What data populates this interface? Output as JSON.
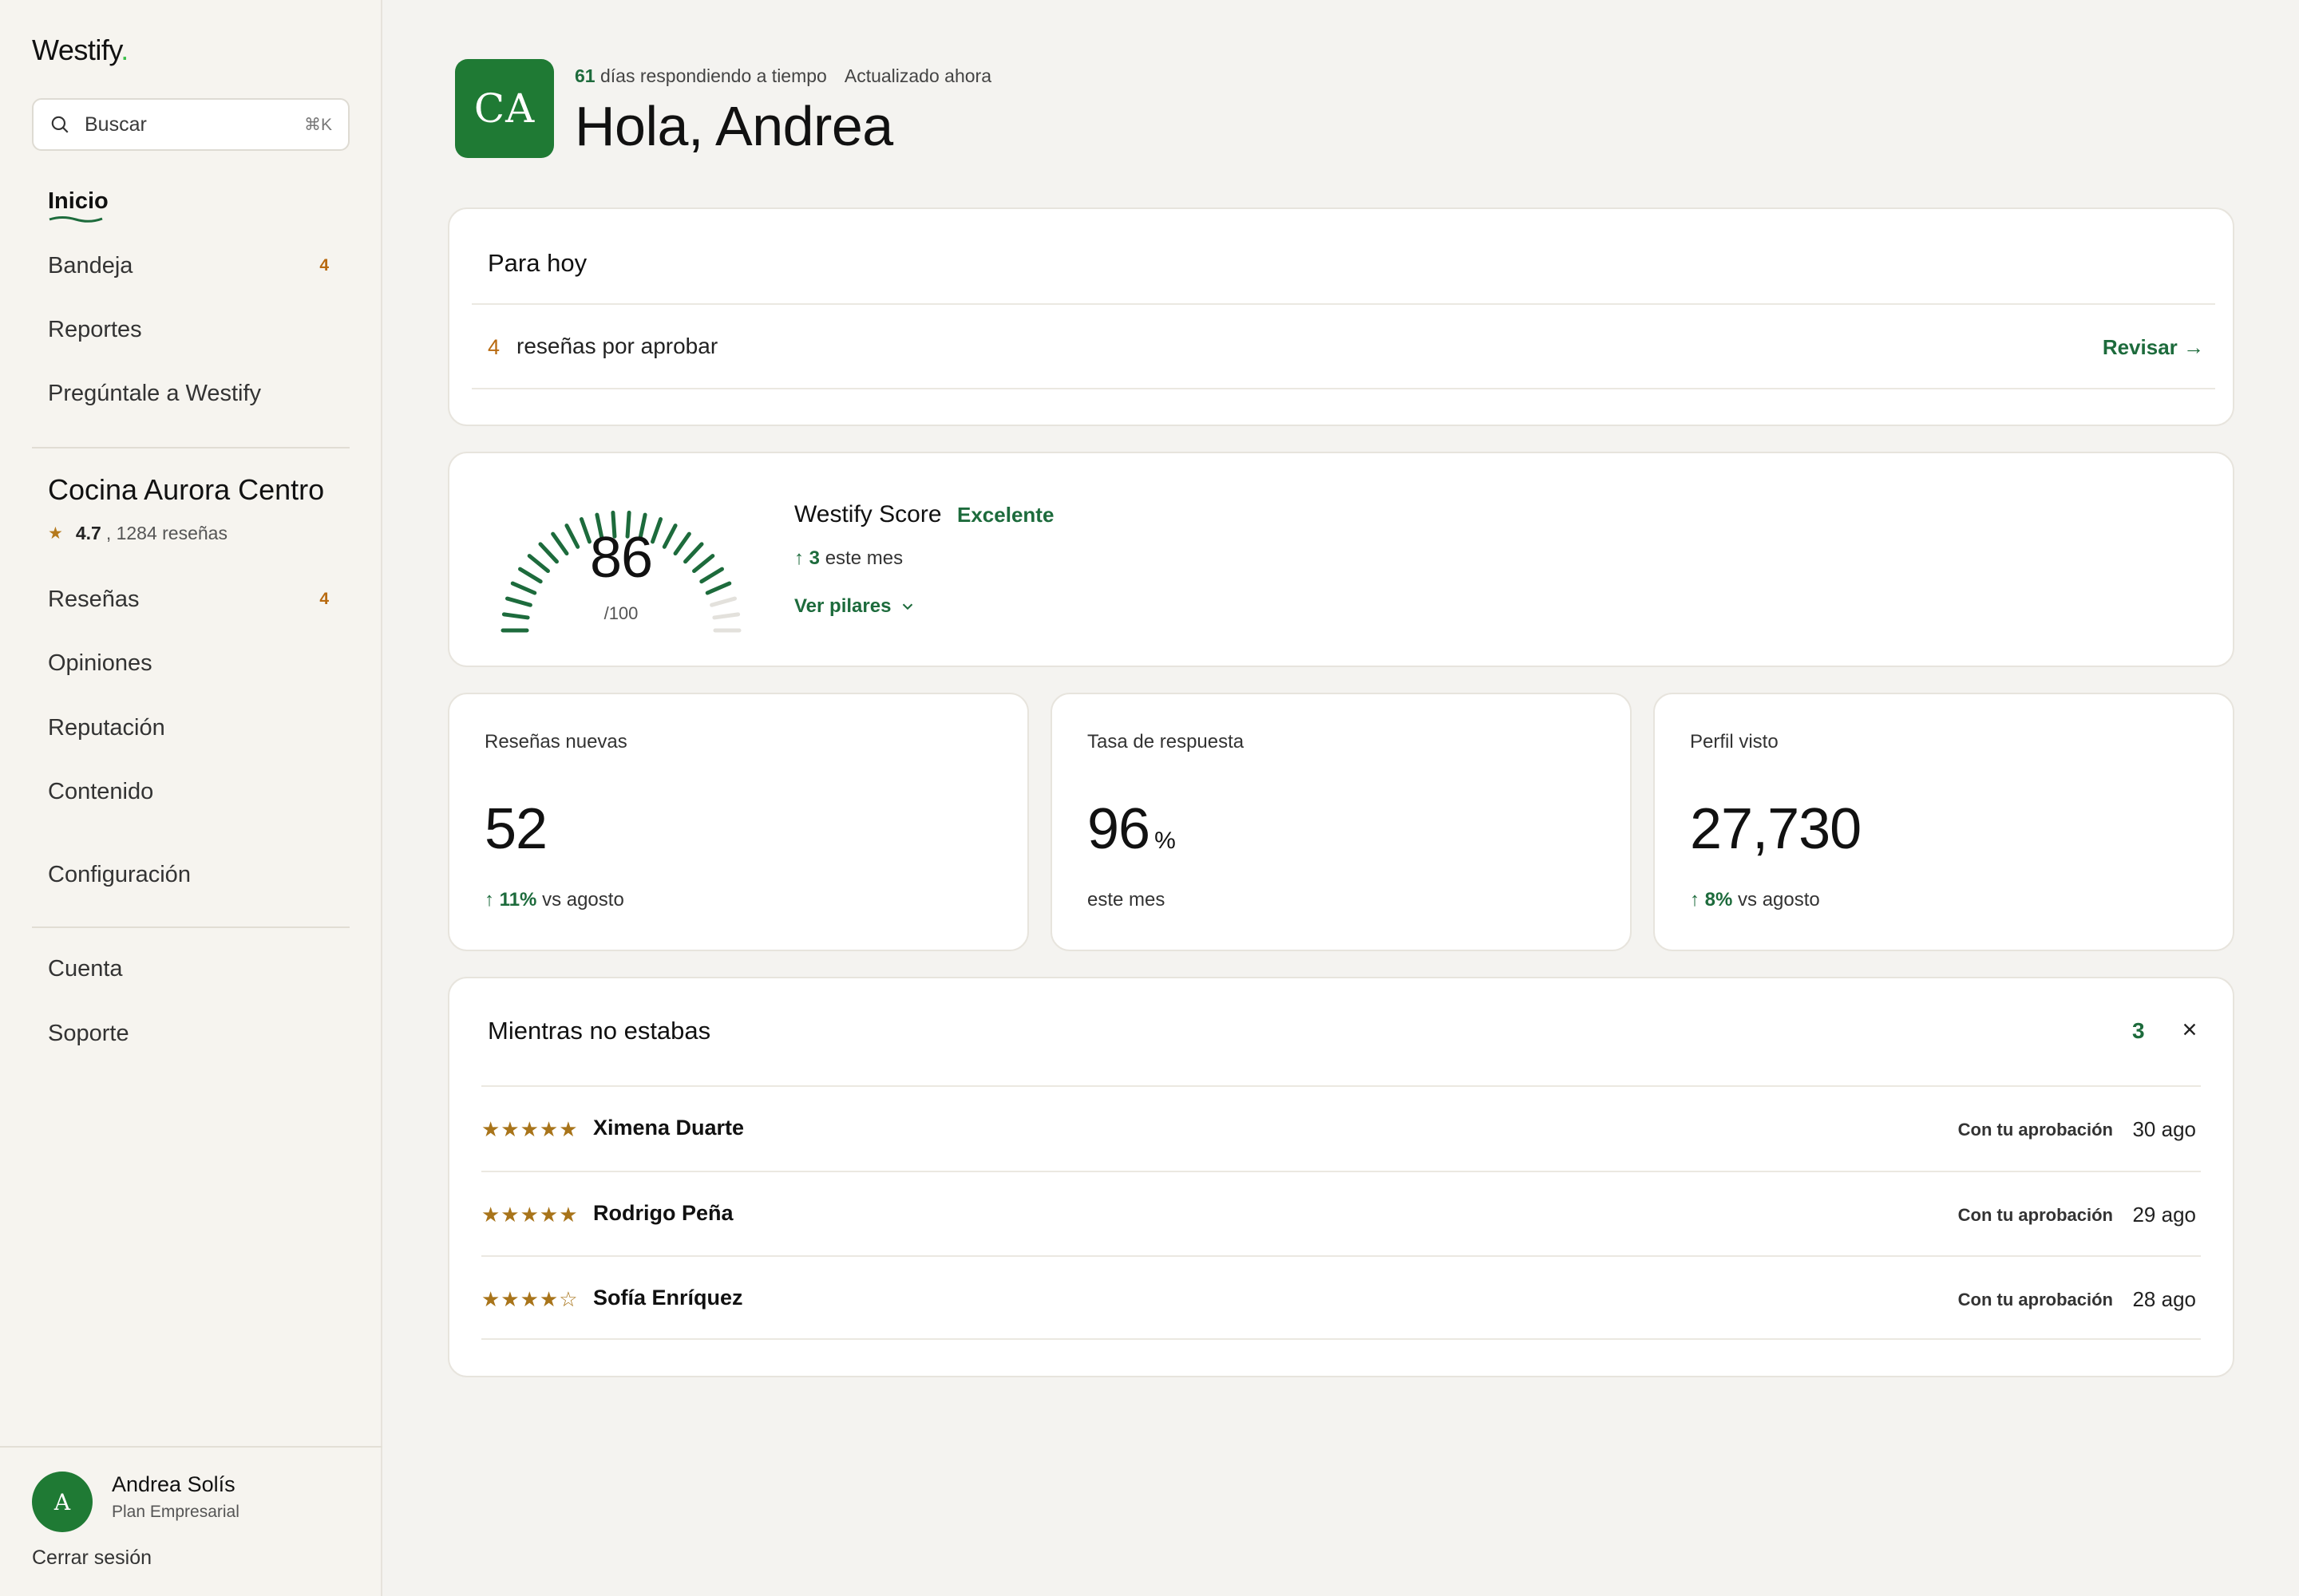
{
  "brand": {
    "name": "Westify",
    "dot": "."
  },
  "search": {
    "placeholder": "Buscar",
    "shortcut": "⌘K"
  },
  "nav_main": [
    {
      "label": "Inicio",
      "active": true
    },
    {
      "label": "Bandeja",
      "badge": "4"
    },
    {
      "label": "Reportes"
    },
    {
      "label": "Pregúntale a Westify"
    }
  ],
  "business": {
    "name": "Cocina Aurora Centro",
    "rating": "4.7",
    "reviews": ", 1284 reseñas"
  },
  "nav_business": [
    {
      "label": "Reseñas",
      "badge": "4"
    },
    {
      "label": "Opiniones"
    },
    {
      "label": "Reputación"
    },
    {
      "label": "Contenido"
    },
    {
      "label": "Configuración"
    }
  ],
  "nav_footer": [
    {
      "label": "Cuenta"
    },
    {
      "label": "Soporte"
    }
  ],
  "user": {
    "initial": "A",
    "name": "Andrea Solís",
    "plan": "Plan Empresarial",
    "logout": "Cerrar sesión"
  },
  "hero": {
    "logo_text": "CA",
    "days": "61",
    "days_text": "días respondiendo a tiempo",
    "updated": "Actualizado ahora",
    "greeting": "Hola, Andrea"
  },
  "today": {
    "title": "Para hoy",
    "count": "4",
    "text": "reseñas por aprobar",
    "action": "Revisar →"
  },
  "score": {
    "value": "86",
    "max": "/100",
    "value_fraction": 0.86,
    "title": "Westify Score",
    "grade": "Excelente",
    "delta": "3",
    "delta_text": "este mes",
    "link": "Ver pilares"
  },
  "metrics": [
    {
      "label": "Reseñas nuevas",
      "value": "52",
      "unit": "",
      "delta": "11%",
      "foot": "vs agosto"
    },
    {
      "label": "Tasa de respuesta",
      "value": "96",
      "unit": "%",
      "delta": "",
      "foot": "este mes"
    },
    {
      "label": "Perfil visto",
      "value": "27,730",
      "unit": "",
      "delta": "8%",
      "foot": "vs agosto"
    }
  ],
  "away": {
    "title": "Mientras no estabas",
    "count": "3",
    "items": [
      {
        "stars": "★★★★★",
        "name": "Ximena Duarte",
        "status": "Con tu aprobación",
        "date": "30 ago"
      },
      {
        "stars": "★★★★★",
        "name": "Rodrigo Peña",
        "status": "Con tu aprobación",
        "date": "29 ago"
      },
      {
        "stars": "★★★★☆",
        "name": "Sofía Enríquez",
        "status": "Con tu aprobación",
        "date": "28 ago"
      }
    ]
  },
  "colors": {
    "accent": "#1d6b3c",
    "brand_green": "#1f7a34",
    "badge": "#b86a10",
    "star": "#a8741a"
  }
}
